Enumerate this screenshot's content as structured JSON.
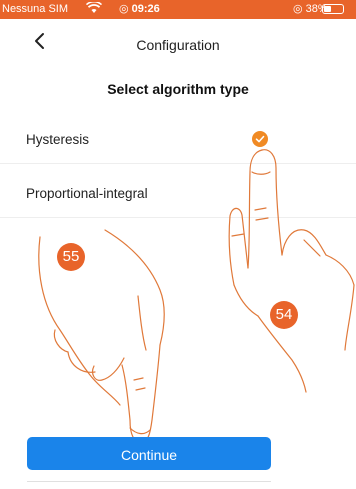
{
  "status_bar": {
    "carrier": "Nessuna SIM",
    "time": "◎ 09:26",
    "battery": "◎ 38%"
  },
  "nav": {
    "title": "Configuration",
    "back_icon": "chevron-left-icon"
  },
  "screen": {
    "section_title": "Select algorithm type",
    "options": [
      {
        "label": "Hysteresis",
        "selected": true
      },
      {
        "label": "Proportional-integral",
        "selected": false
      }
    ],
    "continue_label": "Continue"
  },
  "annotations": {
    "step_left": "55",
    "step_right": "54"
  },
  "colors": {
    "status_bar": "#e8642a",
    "accent": "#f08a24",
    "button": "#1a84ea",
    "badge": "#e8642a"
  }
}
